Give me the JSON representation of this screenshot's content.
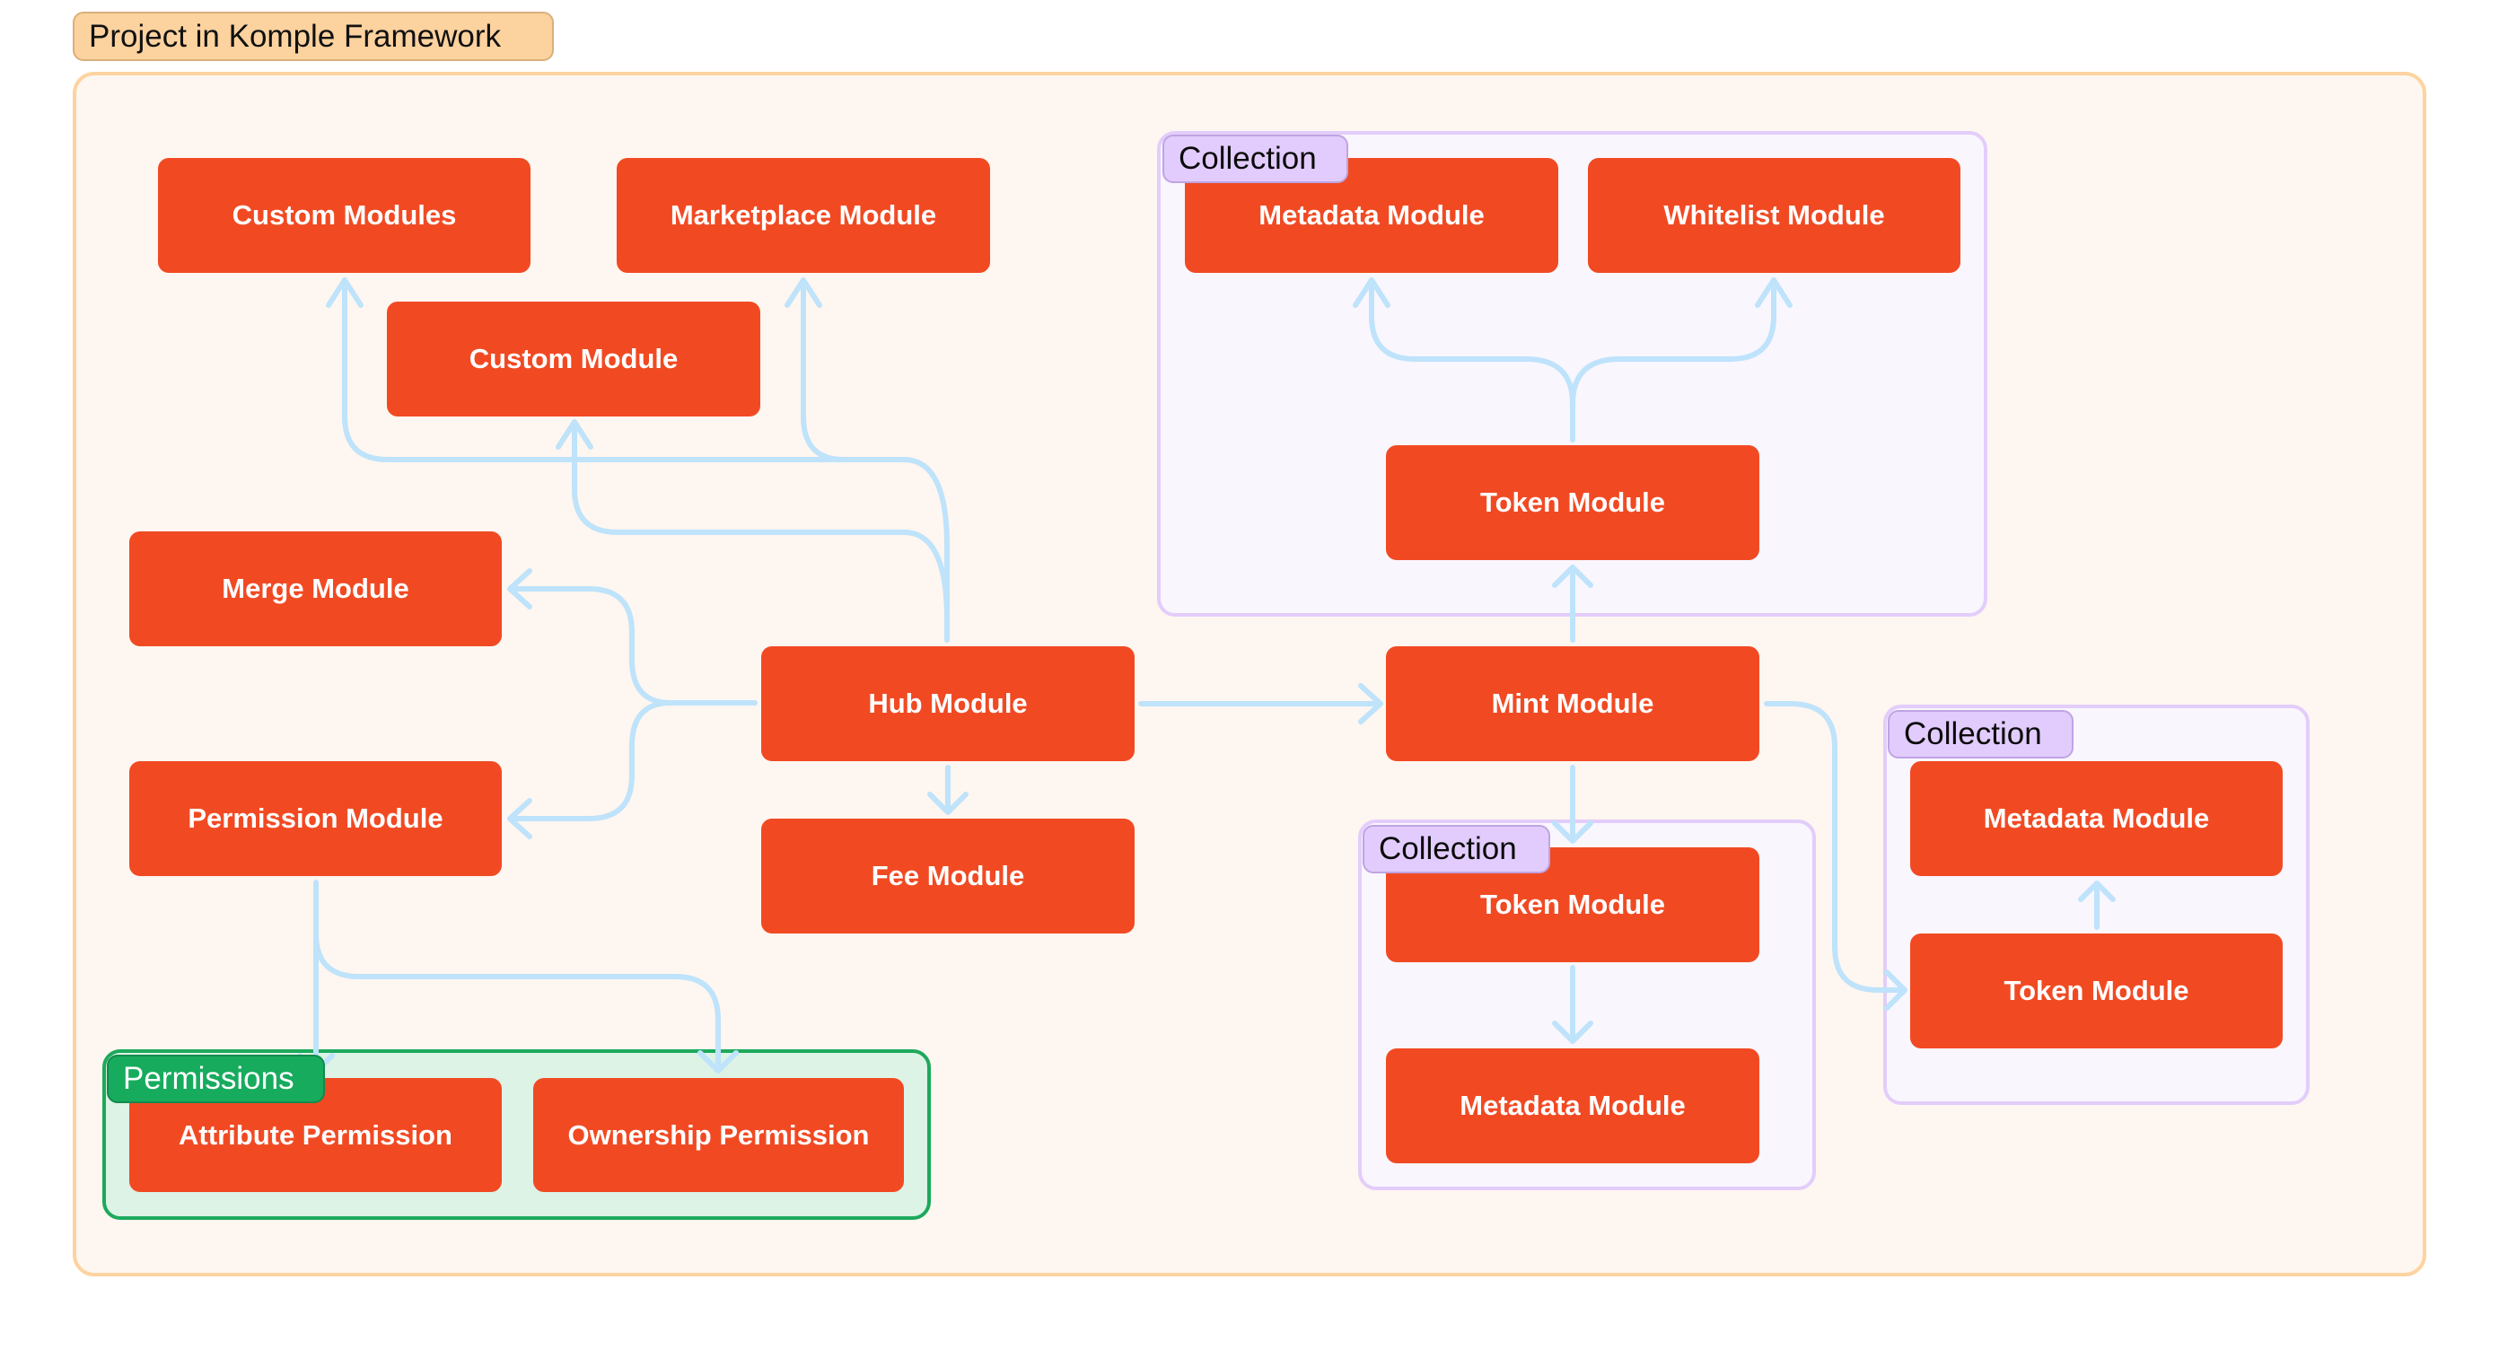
{
  "diagram": {
    "title": "Project in Komple Framework",
    "colors": {
      "module_fill": "#F14A23",
      "module_text": "#FFFFFF",
      "connector": "#BEE3FB",
      "frame_fill": "#FEF6F0",
      "frame_border": "#FDD3A0",
      "title_tag_fill": "#FCD29F",
      "collection_fill": "#F9F6FE",
      "collection_border": "#E3CDFB",
      "collection_tag_fill": "#E2CCFD",
      "permissions_fill": "#DCF3E6",
      "permissions_border": "#1DA95C",
      "permissions_tag_fill": "#17AB5E"
    },
    "groups": {
      "collection_top": {
        "label": "Collection"
      },
      "collection_mid": {
        "label": "Collection"
      },
      "collection_right": {
        "label": "Collection"
      },
      "permissions": {
        "label": "Permissions"
      }
    },
    "modules": {
      "custom_modules": "Custom Modules",
      "marketplace": "Marketplace Module",
      "custom_module": "Custom Module",
      "merge": "Merge Module",
      "permission": "Permission Module",
      "hub": "Hub Module",
      "fee": "Fee Module",
      "mint": "Mint Module",
      "col1_metadata": "Metadata Module",
      "col1_whitelist": "Whitelist Module",
      "col1_token": "Token Module",
      "col2_token": "Token Module",
      "col2_metadata": "Metadata Module",
      "col3_metadata": "Metadata Module",
      "col3_token": "Token Module",
      "attribute_permission": "Attribute Permission",
      "ownership_permission": "Ownership Permission"
    },
    "edges": [
      {
        "from": "Hub Module",
        "to": "Custom Modules"
      },
      {
        "from": "Hub Module",
        "to": "Marketplace Module"
      },
      {
        "from": "Hub Module",
        "to": "Custom Module"
      },
      {
        "from": "Hub Module",
        "to": "Merge Module"
      },
      {
        "from": "Hub Module",
        "to": "Permission Module"
      },
      {
        "from": "Hub Module",
        "to": "Fee Module"
      },
      {
        "from": "Hub Module",
        "to": "Mint Module"
      },
      {
        "from": "Mint Module",
        "to": "Token Module (Collection top)"
      },
      {
        "from": "Token Module (Collection top)",
        "to": "Metadata Module (Collection top)"
      },
      {
        "from": "Token Module (Collection top)",
        "to": "Whitelist Module"
      },
      {
        "from": "Mint Module",
        "to": "Token Module (Collection middle)"
      },
      {
        "from": "Token Module (Collection middle)",
        "to": "Metadata Module (Collection middle)"
      },
      {
        "from": "Mint Module",
        "to": "Token Module (Collection right)"
      },
      {
        "from": "Token Module (Collection right)",
        "to": "Metadata Module (Collection right)"
      },
      {
        "from": "Permission Module",
        "to": "Attribute Permission"
      },
      {
        "from": "Permission Module",
        "to": "Ownership Permission"
      }
    ]
  }
}
